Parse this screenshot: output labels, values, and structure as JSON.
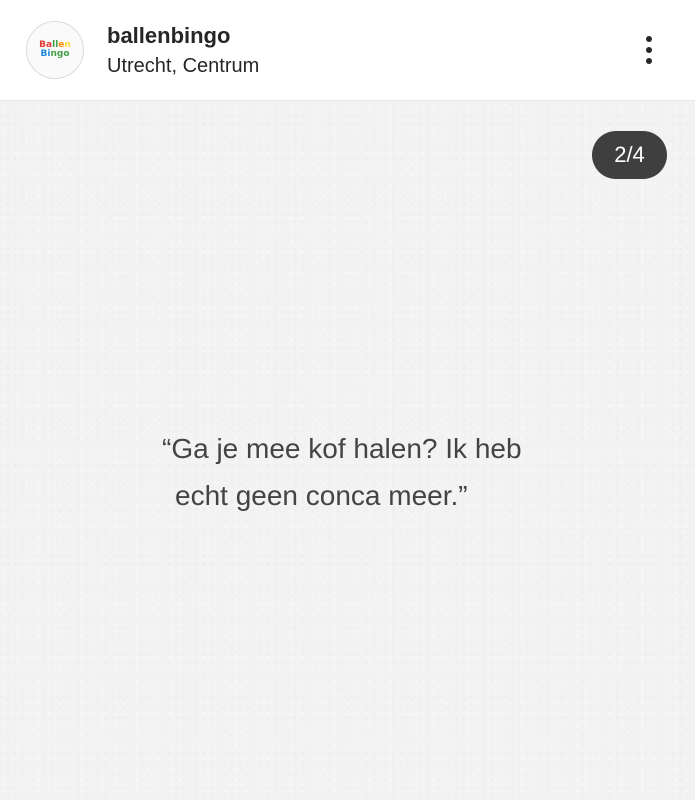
{
  "post_header": {
    "avatar": {
      "logo_line1": [
        "B",
        "a",
        "l",
        "l",
        "e",
        "n"
      ],
      "logo_line1_colors": [
        "#e53935",
        "#e53935",
        "#43a047",
        "#43a047",
        "#fb8c00",
        "#fdd835"
      ],
      "logo_line2": [
        "B",
        "i",
        "n",
        "g",
        "o"
      ],
      "logo_line2_colors": [
        "#1e88e5",
        "#1e88e5",
        "#43a047",
        "#43a047",
        "#43a047"
      ]
    },
    "username": "ballenbingo",
    "location": "Utrecht, Centrum",
    "more_icon": "more-vertical-icon"
  },
  "media": {
    "counter": "2/4",
    "quote_line1": "“Ga je mee kof halen? Ik heb",
    "quote_line2": "echt geen conca meer.”"
  }
}
